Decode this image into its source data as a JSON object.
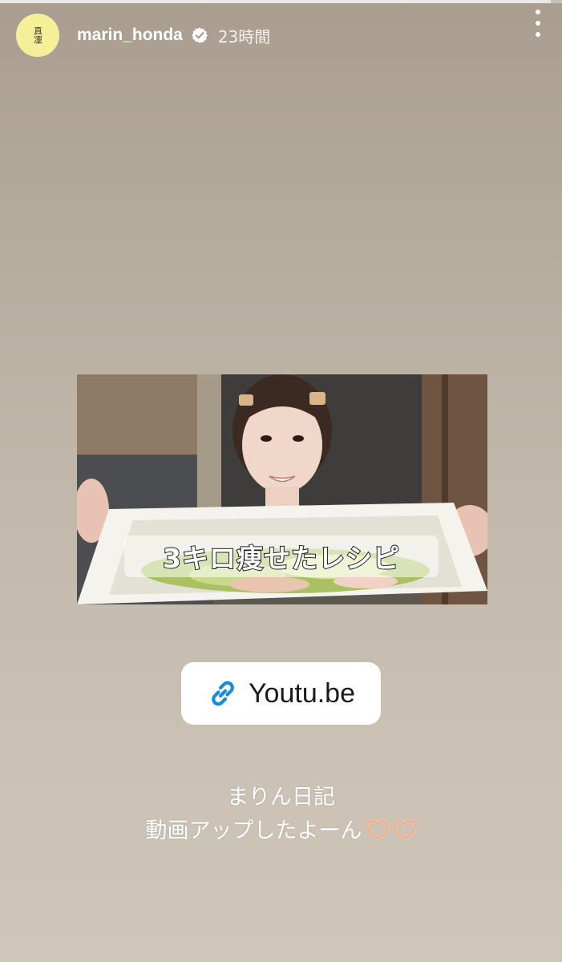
{
  "story": {
    "progress": 0.98,
    "background_top": "#a99d8f",
    "background_bottom": "#cfc6ba"
  },
  "header": {
    "avatar_text": "真凜",
    "username": "marin_honda",
    "verified_icon": "verified-badge-icon",
    "timestamp": "23時間",
    "more_icon": "more-vertical-icon"
  },
  "thumbnail": {
    "caption": "3キロ痩せたレシピ"
  },
  "link_sticker": {
    "icon": "link-icon",
    "label": "Youtu.be",
    "icon_color": "#1a8bd8"
  },
  "caption": {
    "line1": "まりん日記",
    "line2": "動画アップしたよーん",
    "emoji": [
      "heart-hands-icon",
      "heart-hands-icon"
    ]
  }
}
